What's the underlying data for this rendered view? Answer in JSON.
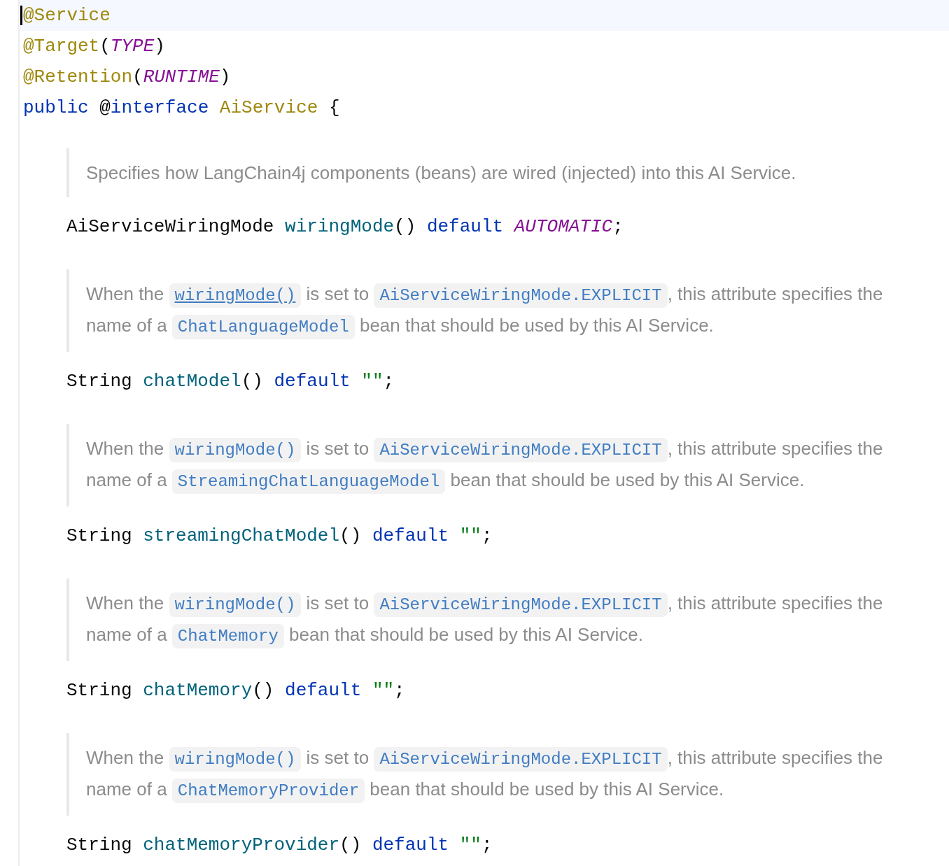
{
  "editor": {
    "lines": [
      {
        "kind": "code",
        "current": true,
        "tokens": [
          {
            "text": "@Service",
            "kind": "annotation"
          }
        ]
      },
      {
        "kind": "code",
        "current": false,
        "tokens": [
          {
            "text": "@Target",
            "kind": "annotation"
          },
          {
            "text": "(",
            "kind": "plain"
          },
          {
            "text": "TYPE",
            "kind": "constant"
          },
          {
            "text": ")",
            "kind": "plain"
          }
        ]
      },
      {
        "kind": "code",
        "current": false,
        "tokens": [
          {
            "text": "@Retention",
            "kind": "annotation"
          },
          {
            "text": "(",
            "kind": "plain"
          },
          {
            "text": "RUNTIME",
            "kind": "constant"
          },
          {
            "text": ")",
            "kind": "plain"
          }
        ]
      },
      {
        "kind": "code",
        "current": false,
        "tokens": [
          {
            "text": "public ",
            "kind": "keyword"
          },
          {
            "text": "@",
            "kind": "plain"
          },
          {
            "text": "interface ",
            "kind": "keyword"
          },
          {
            "text": "AiService",
            "kind": "annotation"
          },
          {
            "text": " {",
            "kind": "plain"
          }
        ]
      },
      {
        "kind": "doc",
        "lines": [
          [
            {
              "text": "Specifies how LangChain4j components (beans) are wired (injected) into this AI Service.",
              "kind": "text"
            }
          ]
        ]
      },
      {
        "kind": "member",
        "current": false,
        "tokens": [
          {
            "text": "AiServiceWiringMode ",
            "kind": "plain"
          },
          {
            "text": "wiringMode",
            "kind": "method"
          },
          {
            "text": "() ",
            "kind": "plain"
          },
          {
            "text": "default ",
            "kind": "keyword"
          },
          {
            "text": "AUTOMATIC",
            "kind": "constant"
          },
          {
            "text": ";",
            "kind": "plain"
          }
        ]
      },
      {
        "kind": "doc",
        "lines": [
          [
            {
              "text": "When the ",
              "kind": "text"
            },
            {
              "text": "wiringMode()",
              "kind": "link",
              "underlined": true
            },
            {
              "text": " is set to ",
              "kind": "text"
            },
            {
              "text": "AiServiceWiringMode.EXPLICIT",
              "kind": "link",
              "underlined": false
            },
            {
              "text": ", this attribute specifies the",
              "kind": "text"
            }
          ],
          [
            {
              "text": "name of a ",
              "kind": "text"
            },
            {
              "text": "ChatLanguageModel",
              "kind": "link",
              "underlined": false
            },
            {
              "text": " bean that should be used by this AI Service.",
              "kind": "text"
            }
          ]
        ]
      },
      {
        "kind": "member",
        "current": false,
        "tokens": [
          {
            "text": "String ",
            "kind": "plain"
          },
          {
            "text": "chatModel",
            "kind": "method"
          },
          {
            "text": "() ",
            "kind": "plain"
          },
          {
            "text": "default ",
            "kind": "keyword"
          },
          {
            "text": "\"\"",
            "kind": "string"
          },
          {
            "text": ";",
            "kind": "plain"
          }
        ]
      },
      {
        "kind": "doc",
        "lines": [
          [
            {
              "text": "When the ",
              "kind": "text"
            },
            {
              "text": "wiringMode()",
              "kind": "link",
              "underlined": false
            },
            {
              "text": " is set to ",
              "kind": "text"
            },
            {
              "text": "AiServiceWiringMode.EXPLICIT",
              "kind": "link",
              "underlined": false
            },
            {
              "text": ", this attribute specifies the",
              "kind": "text"
            }
          ],
          [
            {
              "text": "name of a ",
              "kind": "text"
            },
            {
              "text": "StreamingChatLanguageModel",
              "kind": "link",
              "underlined": false
            },
            {
              "text": " bean that should be used by this AI Service.",
              "kind": "text"
            }
          ]
        ]
      },
      {
        "kind": "member",
        "current": false,
        "tokens": [
          {
            "text": "String ",
            "kind": "plain"
          },
          {
            "text": "streamingChatModel",
            "kind": "method"
          },
          {
            "text": "() ",
            "kind": "plain"
          },
          {
            "text": "default ",
            "kind": "keyword"
          },
          {
            "text": "\"\"",
            "kind": "string"
          },
          {
            "text": ";",
            "kind": "plain"
          }
        ]
      },
      {
        "kind": "doc",
        "lines": [
          [
            {
              "text": "When the ",
              "kind": "text"
            },
            {
              "text": "wiringMode()",
              "kind": "link",
              "underlined": false
            },
            {
              "text": " is set to ",
              "kind": "text"
            },
            {
              "text": "AiServiceWiringMode.EXPLICIT",
              "kind": "link",
              "underlined": false
            },
            {
              "text": ", this attribute specifies the",
              "kind": "text"
            }
          ],
          [
            {
              "text": "name of a ",
              "kind": "text"
            },
            {
              "text": "ChatMemory",
              "kind": "link",
              "underlined": false
            },
            {
              "text": " bean that should be used by this AI Service.",
              "kind": "text"
            }
          ]
        ]
      },
      {
        "kind": "member",
        "current": false,
        "tokens": [
          {
            "text": "String ",
            "kind": "plain"
          },
          {
            "text": "chatMemory",
            "kind": "method"
          },
          {
            "text": "() ",
            "kind": "plain"
          },
          {
            "text": "default ",
            "kind": "keyword"
          },
          {
            "text": "\"\"",
            "kind": "string"
          },
          {
            "text": ";",
            "kind": "plain"
          }
        ]
      },
      {
        "kind": "doc",
        "lines": [
          [
            {
              "text": "When the ",
              "kind": "text"
            },
            {
              "text": "wiringMode()",
              "kind": "link",
              "underlined": false
            },
            {
              "text": " is set to ",
              "kind": "text"
            },
            {
              "text": "AiServiceWiringMode.EXPLICIT",
              "kind": "link",
              "underlined": false
            },
            {
              "text": ", this attribute specifies the",
              "kind": "text"
            }
          ],
          [
            {
              "text": "name of a ",
              "kind": "text"
            },
            {
              "text": "ChatMemoryProvider",
              "kind": "link",
              "underlined": false
            },
            {
              "text": " bean that should be used by this AI Service.",
              "kind": "text"
            }
          ]
        ]
      },
      {
        "kind": "member",
        "current": false,
        "tokens": [
          {
            "text": "String ",
            "kind": "plain"
          },
          {
            "text": "chatMemoryProvider",
            "kind": "method"
          },
          {
            "text": "() ",
            "kind": "plain"
          },
          {
            "text": "default ",
            "kind": "keyword"
          },
          {
            "text": "\"\"",
            "kind": "string"
          },
          {
            "text": ";",
            "kind": "plain"
          }
        ]
      }
    ]
  }
}
